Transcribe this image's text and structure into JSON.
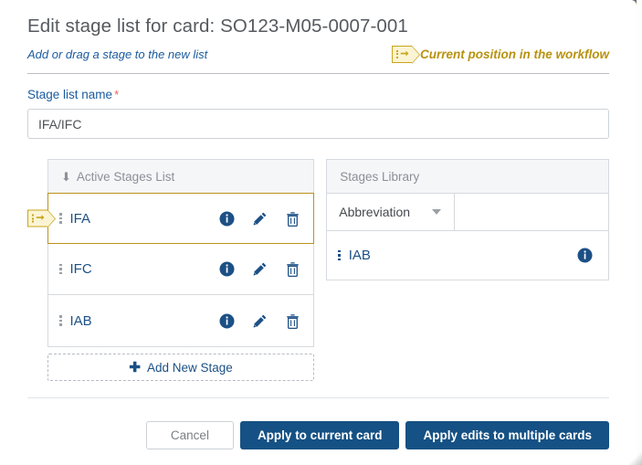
{
  "dialog": {
    "title": "Edit stage list for card: SO123-M05-0007-001",
    "subtitle": "Add or drag a stage to the new list",
    "legend_label": "Current position in the workflow",
    "legend_icon": "current-position-marker-icon"
  },
  "form": {
    "stage_list_name_label": "Stage list name",
    "required_mark": "*",
    "stage_list_name_value": "IFA/IFC",
    "stage_list_name_placeholder": "Stage list name"
  },
  "active_panel": {
    "header": "Active Stages List",
    "header_icon": "arrow-down-icon",
    "rows": [
      {
        "name": "IFA",
        "current": true,
        "drag_icon": "drag-handle-icon",
        "info_icon": "info-icon",
        "edit_icon": "pencil-icon",
        "delete_icon": "trash-icon"
      },
      {
        "name": "IFC",
        "current": false,
        "drag_icon": "drag-handle-icon",
        "info_icon": "info-icon",
        "edit_icon": "pencil-icon",
        "delete_icon": "trash-icon"
      },
      {
        "name": "IAB",
        "current": false,
        "drag_icon": "drag-handle-icon",
        "info_icon": "info-icon",
        "edit_icon": "pencil-icon",
        "delete_icon": "trash-icon"
      }
    ],
    "add_button_label": "Add New Stage",
    "add_button_icon": "plus-icon"
  },
  "library_panel": {
    "header": "Stages Library",
    "filter_selected": "Abbreviation",
    "filter_options": [
      "Abbreviation"
    ],
    "filter_icon": "chevron-down-icon",
    "rows": [
      {
        "name": "IAB",
        "drag_icon": "drag-handle-icon",
        "info_icon": "info-icon"
      }
    ]
  },
  "footer": {
    "cancel_label": "Cancel",
    "apply_current_label": "Apply to current card",
    "apply_multiple_label": "Apply edits to multiple cards"
  },
  "colors": {
    "primary": "#155184",
    "link": "#1c5085",
    "gold": "#b8920f",
    "gold_border": "#c8a51a",
    "required": "#e8685a",
    "panel_header_bg": "#f5f6f8",
    "muted_text": "#8b9097"
  }
}
